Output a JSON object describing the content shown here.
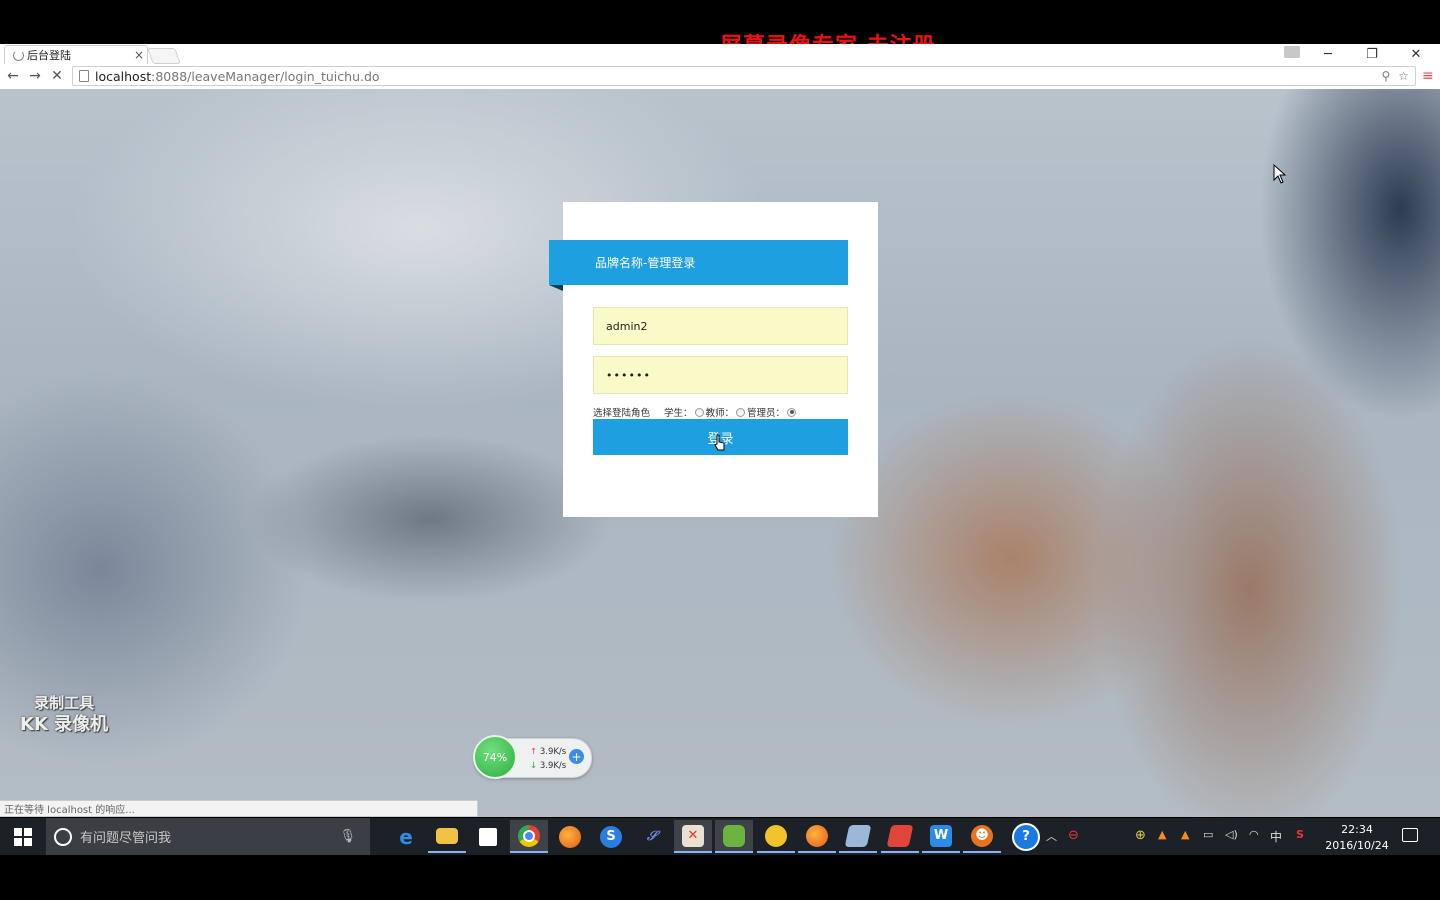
{
  "watermark_top": "屏幕录像专家  未注册",
  "browser": {
    "tab_title": "后台登陆",
    "tab_close": "×",
    "url_host": "localhost",
    "url_rest": ":8088/leaveManager/login_tuichu.do",
    "back": "←",
    "forward": "→",
    "stop": "✕",
    "status_text": "正在等待 localhost 的响应..."
  },
  "login": {
    "header": "品牌名称-管理登录",
    "username_value": "admin2",
    "password_value": "••••••",
    "role_label": "选择登陆角色",
    "roles": [
      {
        "label": "学生：",
        "checked": false
      },
      {
        "label": "教师：",
        "checked": false
      },
      {
        "label": "管理员：",
        "checked": true
      }
    ],
    "submit_label": "登录"
  },
  "kk_watermark": {
    "line1": "录制工具",
    "line2": "KK 录像机"
  },
  "net_widget": {
    "percent": "74%",
    "up": "3.9K/s",
    "down": "3.9K/s",
    "plus": "+"
  },
  "taskbar": {
    "search_placeholder": "有问题尽管问我",
    "time": "22:34",
    "date": "2016/10/24",
    "ime": "中",
    "colors": {
      "accent": "#1e9fe0",
      "taskbar": "#1c2128"
    }
  }
}
